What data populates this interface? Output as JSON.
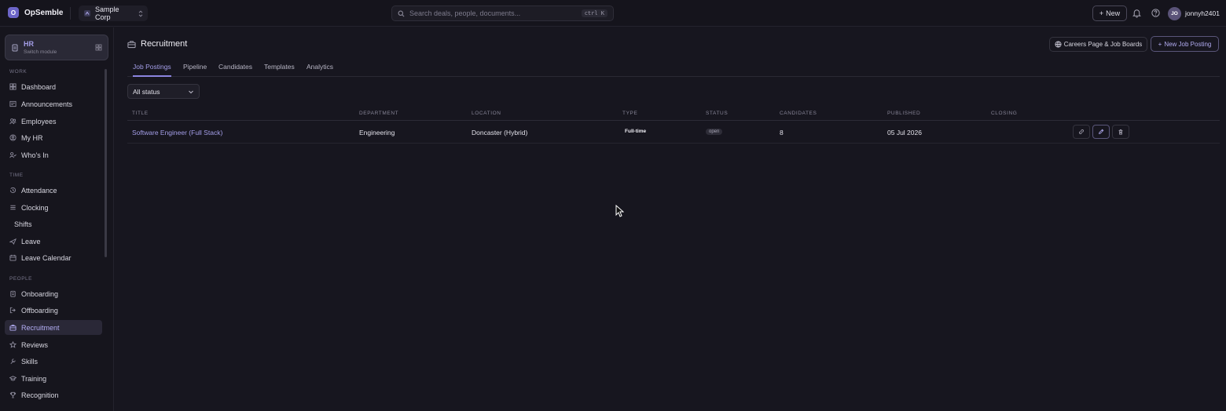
{
  "app": {
    "logo_letter": "O",
    "name": "OpSemble"
  },
  "org": {
    "name": "Sample Corp"
  },
  "search": {
    "placeholder": "Search deals, people, documents...",
    "shortcut": "ctrl K"
  },
  "topbar": {
    "new_label": "New",
    "username": "jonnyh2401",
    "avatar_initials": "JO"
  },
  "module": {
    "name": "HR",
    "subtitle": "Switch module"
  },
  "sidebar": {
    "sections": [
      {
        "label": "WORK",
        "items": [
          "Dashboard",
          "Announcements",
          "Employees",
          "My HR",
          "Who's In"
        ]
      },
      {
        "label": "TIME",
        "items": [
          "Attendance",
          "Clocking",
          "Shifts",
          "Leave",
          "Leave Calendar"
        ]
      },
      {
        "label": "PEOPLE",
        "items": [
          "Onboarding",
          "Offboarding",
          "Recruitment",
          "Reviews",
          "Skills",
          "Training",
          "Recognition"
        ]
      }
    ],
    "active_item": "Recruitment"
  },
  "page": {
    "title": "Recruitment",
    "careers_button": "Careers Page & Job Boards",
    "new_job_button": "New Job Posting"
  },
  "tabs": [
    "Job Postings",
    "Pipeline",
    "Candidates",
    "Templates",
    "Analytics"
  ],
  "active_tab": "Job Postings",
  "filter": {
    "value": "All status"
  },
  "table": {
    "columns": [
      "TITLE",
      "DEPARTMENT",
      "LOCATION",
      "TYPE",
      "STATUS",
      "CANDIDATES",
      "PUBLISHED",
      "CLOSING"
    ],
    "rows": [
      {
        "title": "Software Engineer (Full Stack)",
        "department": "Engineering",
        "location": "Doncaster (Hybrid)",
        "type": "Full-time",
        "status": "open",
        "candidates": "8",
        "published": "05 Jul 2026",
        "closing": ""
      }
    ]
  },
  "colors": {
    "accent": "#a49ee8",
    "background": "#17161f",
    "sidebar": "#16151d"
  }
}
